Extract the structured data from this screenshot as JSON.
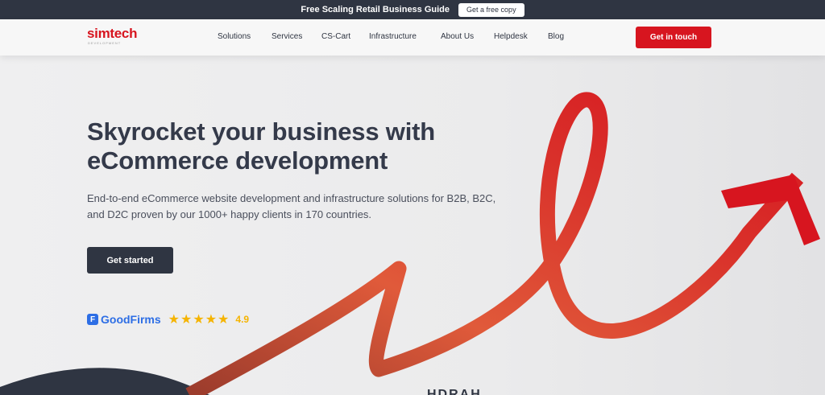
{
  "promo": {
    "text": "Free Scaling Retail Business Guide",
    "button": "Get a free copy"
  },
  "logo": {
    "name": "simtech",
    "subtitle": "DEVELOPMENT"
  },
  "nav": {
    "items": [
      "Solutions",
      "Services",
      "CS-Cart",
      "Infrastructure",
      "About Us",
      "Helpdesk",
      "Blog"
    ],
    "cta": "Get in touch"
  },
  "hero": {
    "title_line1": "Skyrocket your business with",
    "title_line2": "eCommerce development",
    "description_line1": "End-to-end eCommerce website development and infrastructure solutions for B2B, B2C,",
    "description_line2": "and D2C proven by our 1000+ happy clients in 170 countries.",
    "button": "Get started"
  },
  "rating": {
    "brand": "GoodFirms",
    "brand_icon": "goodfirms-icon",
    "stars": "★★★★★",
    "star_count": 5,
    "score": "4.9"
  },
  "partial_heading": "HDRAH",
  "colors": {
    "brand_red": "#d7151f",
    "dark": "#2f3542",
    "goodfirms_blue": "#2d6ee5",
    "star": "#f5b400"
  }
}
